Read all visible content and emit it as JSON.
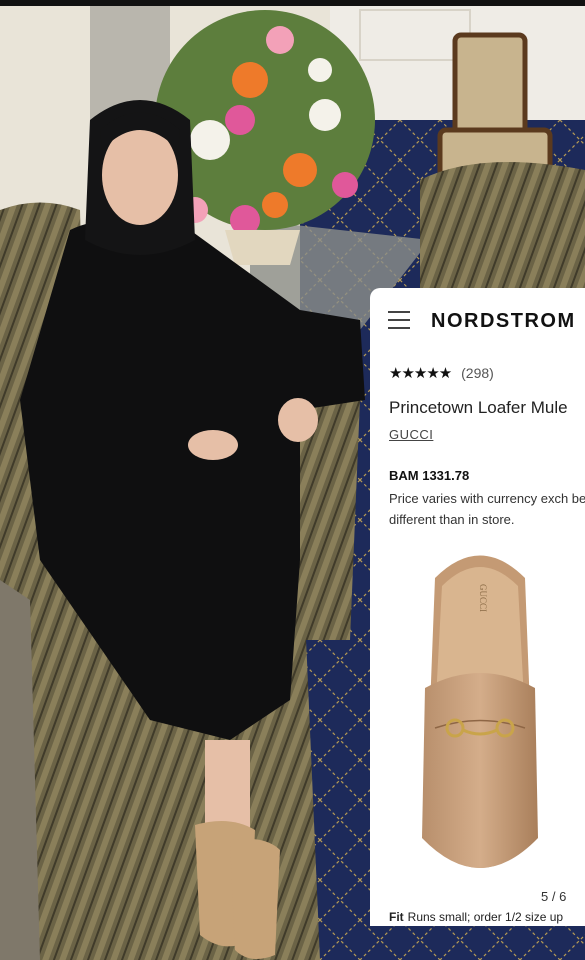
{
  "card": {
    "brand": "NORDSTROM",
    "rating": {
      "stars_text": "★★★★★",
      "value": 5,
      "count_text": "(298)"
    },
    "product_name": "Princetown Loafer Mule",
    "product_brand": "GUCCI",
    "price": "BAM 1331.78",
    "price_note": "Price varies with currency exch be different than in store.",
    "image_counter": "5 / 6",
    "fit_label": "Fit",
    "fit_text": "Runs small; order 1/2 size up",
    "shoe_insole_text": "GUCCI"
  },
  "icons": [
    "menu-icon",
    "star-icon"
  ],
  "colors": {
    "card_bg": "#ffffff",
    "shoe_tan": "#c79f7c",
    "carpet": "#1d2a5a",
    "sofa_stripe": "#6b6346"
  }
}
